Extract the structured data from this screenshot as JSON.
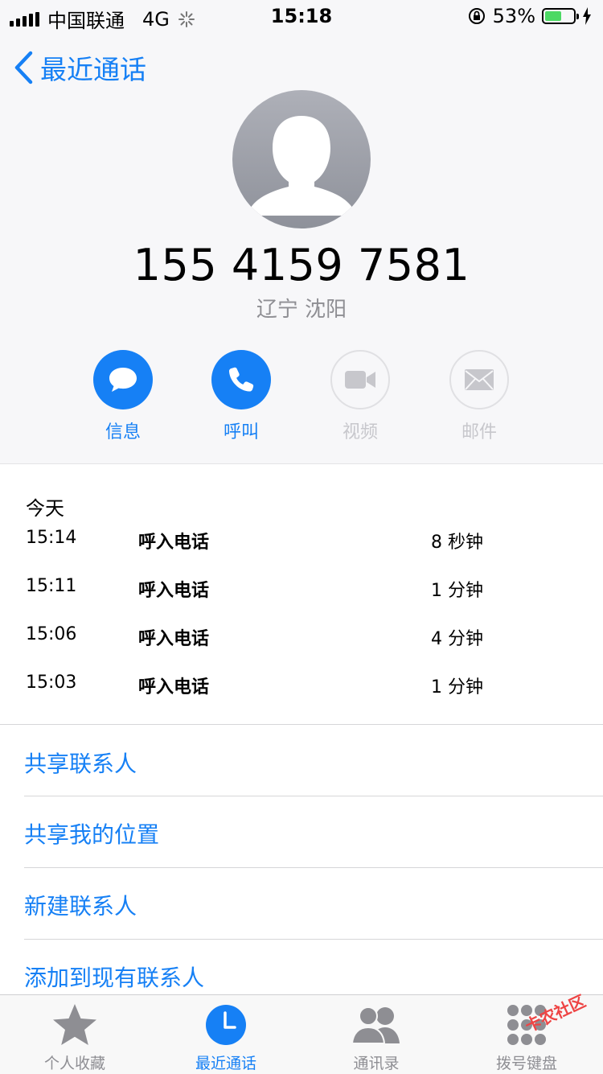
{
  "status_bar": {
    "carrier": "中国联通",
    "network": "4G",
    "time": "15:18",
    "battery": "53%"
  },
  "nav": {
    "back_label": "最近通话"
  },
  "contact": {
    "number": "155 4159 7581",
    "location": "辽宁 沈阳"
  },
  "actions": [
    {
      "label": "信息",
      "enabled": true
    },
    {
      "label": "呼叫",
      "enabled": true
    },
    {
      "label": "视频",
      "enabled": false
    },
    {
      "label": "邮件",
      "enabled": false
    }
  ],
  "history": {
    "day": "今天",
    "calls": [
      {
        "time": "15:14",
        "type": "呼入电话",
        "duration": "8 秒钟"
      },
      {
        "time": "15:11",
        "type": "呼入电话",
        "duration": "1 分钟"
      },
      {
        "time": "15:06",
        "type": "呼入电话",
        "duration": "4 分钟"
      },
      {
        "time": "15:03",
        "type": "呼入电话",
        "duration": "1 分钟"
      }
    ]
  },
  "options": [
    "共享联系人",
    "共享我的位置",
    "新建联系人",
    "添加到现有联系人"
  ],
  "tabbar": {
    "items": [
      "个人收藏",
      "最近通话",
      "通讯录",
      "拨号键盘"
    ],
    "active": "最近通话"
  },
  "watermark": "卡农社区",
  "colors": {
    "accent": "#1680f5",
    "battery_green": "#4cd964",
    "inactive": "#8e8e93"
  }
}
